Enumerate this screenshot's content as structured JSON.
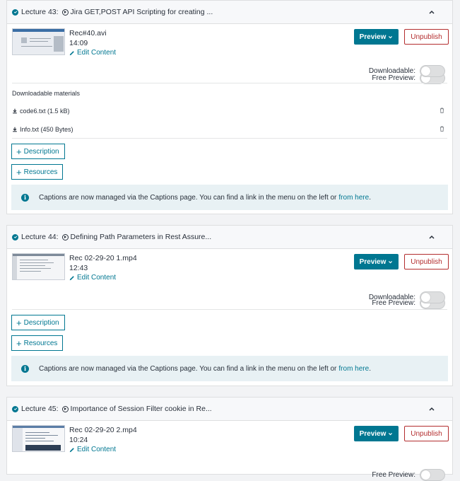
{
  "lectures": [
    {
      "number": "Lecture 43:",
      "title": "Jira GET,POST API Scripting for creating ...",
      "file": "Rec#40.avi",
      "duration": "14:09",
      "edit_label": "Edit Content",
      "preview_label": "Preview",
      "unpublish_label": "Unpublish",
      "free_preview_label": "Free Preview:",
      "downloadable_label": "Downloadable:",
      "free_preview": false,
      "downloadable": false,
      "materials_title": "Downloadable materials",
      "materials": [
        {
          "name": "code6.txt (1.5 kB)"
        },
        {
          "name": "Info.txt (450 Bytes)"
        }
      ],
      "description_label": "Description",
      "resources_label": "Resources",
      "captions": {
        "text_before": "Captions are now managed via the Captions page. You can find a link in the menu on the left or",
        "link": "from here",
        "text_after": "."
      }
    },
    {
      "number": "Lecture 44:",
      "title": "Defining Path Parameters in Rest Assure...",
      "file": "Rec 02-29-20 1.mp4",
      "duration": "12:43",
      "edit_label": "Edit Content",
      "preview_label": "Preview",
      "unpublish_label": "Unpublish",
      "free_preview_label": "Free Preview:",
      "downloadable_label": "Downloadable:",
      "free_preview": false,
      "downloadable": false,
      "description_label": "Description",
      "resources_label": "Resources",
      "captions": {
        "text_before": "Captions are now managed via the Captions page. You can find a link in the menu on the left or",
        "link": "from here",
        "text_after": "."
      }
    },
    {
      "number": "Lecture 45:",
      "title": "Importance of Session Filter cookie in Re...",
      "file": "Rec 02-29-20 2.mp4",
      "duration": "10:24",
      "edit_label": "Edit Content",
      "preview_label": "Preview",
      "unpublish_label": "Unpublish",
      "free_preview_label": "Free Preview:",
      "free_preview": false
    }
  ],
  "colors": {
    "accent": "#007791",
    "danger": "#b32d2e",
    "caption_bg": "#e8f1f4"
  }
}
